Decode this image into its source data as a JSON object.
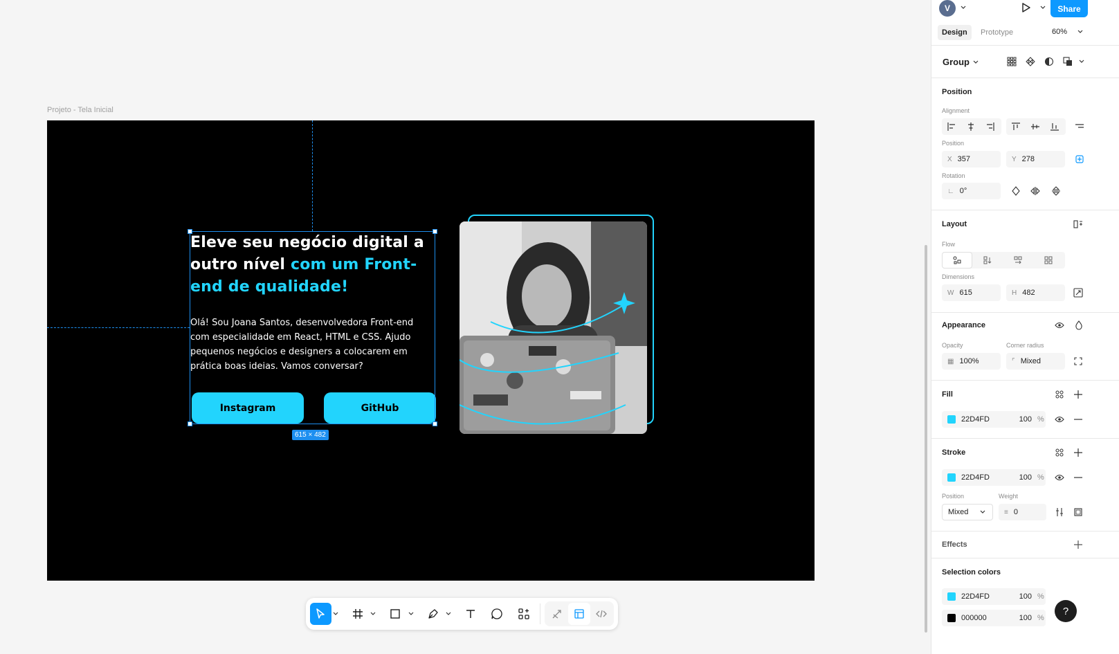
{
  "canvas": {
    "frame_label": "Projeto - Tela Inicial",
    "size_badge": "615 × 482",
    "hero": {
      "title_part1": "Eleve seu negócio digital a outro nível ",
      "title_part2": "com um Front-end de qualidade!",
      "description": "Olá! Sou Joana Santos, desenvolvedora Front-end com especialidade em React, HTML e CSS. Ajudo pequenos negócios e designers a colocarem em prática boas ideias. Vamos conversar?",
      "button_instagram": "Instagram",
      "button_github": "GitHub"
    }
  },
  "header": {
    "avatar_initial": "V",
    "share_label": "Share",
    "tab_design": "Design",
    "tab_prototype": "Prototype",
    "zoom": "60%"
  },
  "panel": {
    "selection_type": "Group",
    "position_title": "Position",
    "alignment_label": "Alignment",
    "position_label": "Position",
    "x_prefix": "X",
    "x_value": "357",
    "y_prefix": "Y",
    "y_value": "278",
    "rotation_label": "Rotation",
    "rotation_value": "0°",
    "layout_title": "Layout",
    "flow_label": "Flow",
    "dimensions_label": "Dimensions",
    "w_prefix": "W",
    "w_value": "615",
    "h_prefix": "H",
    "h_value": "482",
    "appearance_title": "Appearance",
    "opacity_label": "Opacity",
    "opacity_value": "100%",
    "corner_radius_label": "Corner radius",
    "corner_radius_value": "Mixed",
    "fill_title": "Fill",
    "fill_hex": "22D4FD",
    "fill_opacity": "100",
    "stroke_title": "Stroke",
    "stroke_hex": "22D4FD",
    "stroke_opacity": "100",
    "stroke_position_label": "Position",
    "stroke_position_value": "Mixed",
    "stroke_weight_label": "Weight",
    "stroke_weight_value": "0",
    "effects_title": "Effects",
    "selection_colors_title": "Selection colors",
    "selection_colors": [
      {
        "hex": "22D4FD",
        "opacity": "100"
      },
      {
        "hex": "000000",
        "opacity": "100"
      }
    ],
    "percent_sign": "%"
  },
  "colors": {
    "accent": "#22D4FD",
    "figma_blue": "#0d99ff",
    "frame_bg": "#000000"
  },
  "help_label": "?"
}
